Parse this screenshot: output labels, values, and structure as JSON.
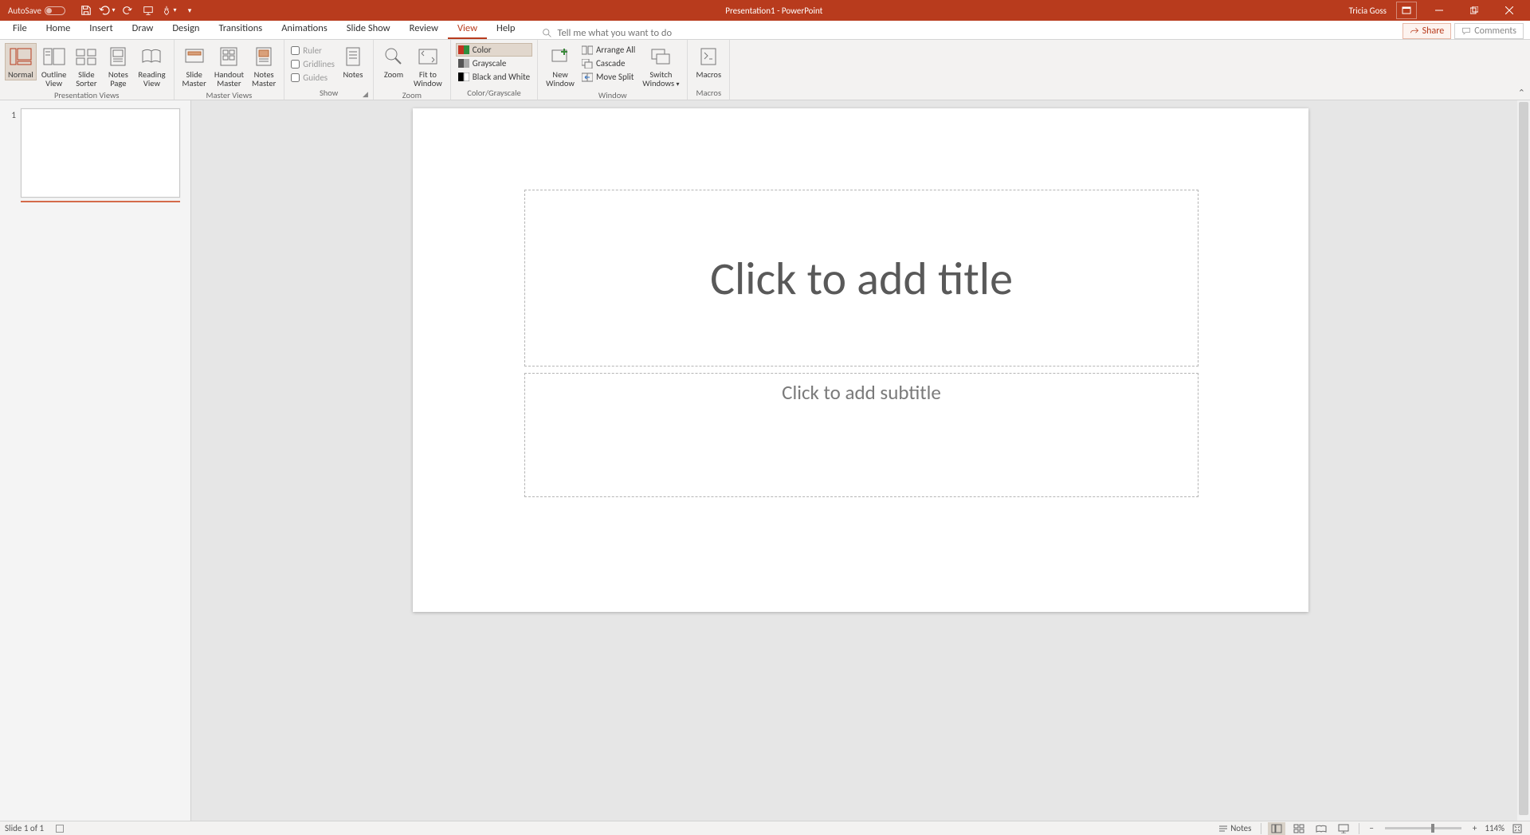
{
  "titlebar": {
    "autosave_label": "AutoSave",
    "autosave_state": "Off",
    "doc_title": "Presentation1 - PowerPoint",
    "username": "Tricia Goss"
  },
  "tabs": {
    "items": [
      "File",
      "Home",
      "Insert",
      "Draw",
      "Design",
      "Transitions",
      "Animations",
      "Slide Show",
      "Review",
      "View",
      "Help"
    ],
    "active_index": 9,
    "tellme_placeholder": "Tell me what you want to do",
    "share": "Share",
    "comments": "Comments"
  },
  "ribbon": {
    "groups": {
      "presentation_views": {
        "label": "Presentation Views",
        "buttons": [
          {
            "label": "Normal",
            "active": true
          },
          {
            "label": "Outline\nView"
          },
          {
            "label": "Slide\nSorter"
          },
          {
            "label": "Notes\nPage"
          },
          {
            "label": "Reading\nView"
          }
        ]
      },
      "master_views": {
        "label": "Master Views",
        "buttons": [
          {
            "label": "Slide\nMaster"
          },
          {
            "label": "Handout\nMaster"
          },
          {
            "label": "Notes\nMaster"
          }
        ]
      },
      "show": {
        "label": "Show",
        "checks": [
          "Ruler",
          "Gridlines",
          "Guides"
        ],
        "notes": "Notes"
      },
      "zoom": {
        "label": "Zoom",
        "zoom_btn": "Zoom",
        "fit_btn": "Fit to\nWindow"
      },
      "color": {
        "label": "Color/Grayscale",
        "options": [
          "Color",
          "Grayscale",
          "Black and White"
        ]
      },
      "window": {
        "label": "Window",
        "new_window": "New\nWindow",
        "arrange": "Arrange All",
        "cascade": "Cascade",
        "move_split": "Move Split",
        "switch": "Switch\nWindows"
      },
      "macros": {
        "label": "Macros",
        "btn": "Macros"
      }
    }
  },
  "slide_panel": {
    "thumbs": [
      {
        "num": "1"
      }
    ]
  },
  "slide": {
    "title_placeholder": "Click to add title",
    "subtitle_placeholder": "Click to add subtitle"
  },
  "statusbar": {
    "slide_pos": "Slide 1 of 1",
    "notes": "Notes",
    "zoom_pct": "114%"
  }
}
